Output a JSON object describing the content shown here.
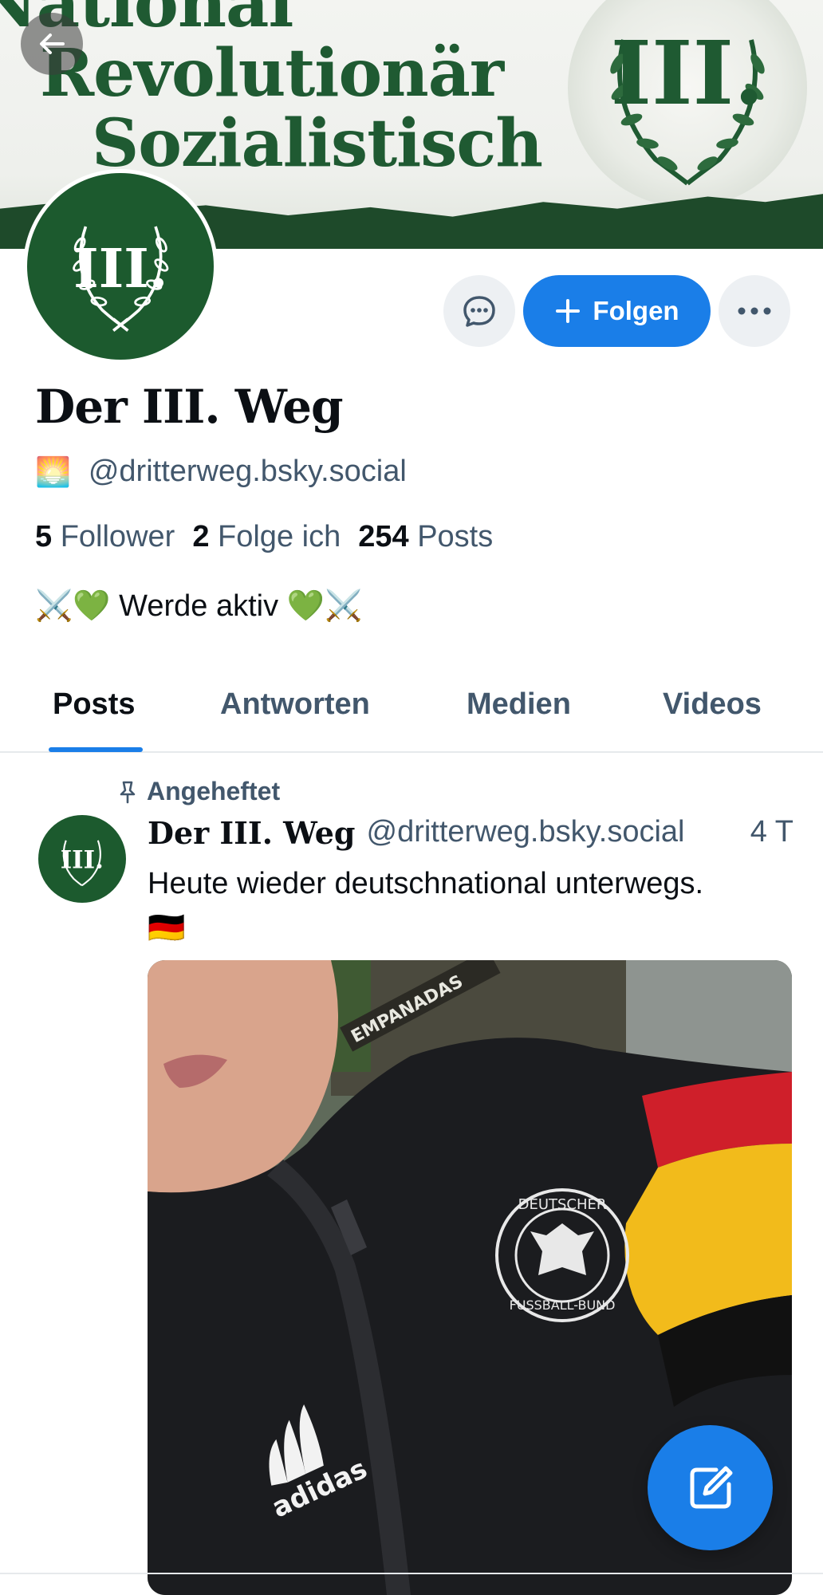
{
  "banner": {
    "line1": "National",
    "line2": "Revolutionär",
    "line3": "Sozialistisch",
    "emblem_text": "III."
  },
  "avatar": {
    "emblem_text": "III."
  },
  "actions": {
    "follow_label": "Folgen",
    "message_icon": "chat-bubble-icon",
    "more_icon": "ellipsis-icon"
  },
  "profile": {
    "name": "Der III. Weg",
    "handle_emoji": "🌅",
    "handle": "@dritterweg.bsky.social",
    "followers_count": "5",
    "followers_label": "Follower",
    "following_count": "2",
    "following_label": "Folge ich",
    "posts_count": "254",
    "posts_label": "Posts",
    "bio": "⚔️💚 Werde aktiv 💚⚔️"
  },
  "tabs": [
    {
      "label": "Posts",
      "active": true
    },
    {
      "label": "Antworten",
      "active": false
    },
    {
      "label": "Medien",
      "active": false
    },
    {
      "label": "Videos",
      "active": false
    }
  ],
  "post": {
    "pinned_label": "Angeheftet",
    "author": "Der III. Weg",
    "handle": "@dritterweg.bsky.social",
    "time": "4 T",
    "text": "Heute wieder deutschnational unterwegs.",
    "flag": "🇩🇪",
    "image_alt": "Selfie in black track jacket with Deutscher Fussball-Bund emblem",
    "image_text_shop": "EMPANADAS",
    "image_text_brand": "adidas",
    "image_text_badge_top": "DEUTSCHER",
    "image_text_badge_bottom": "FUSSBALL-BUND"
  },
  "colors": {
    "accent": "#1a7ee8",
    "banner_green": "#1f5a32",
    "text_secondary": "#42576c"
  }
}
